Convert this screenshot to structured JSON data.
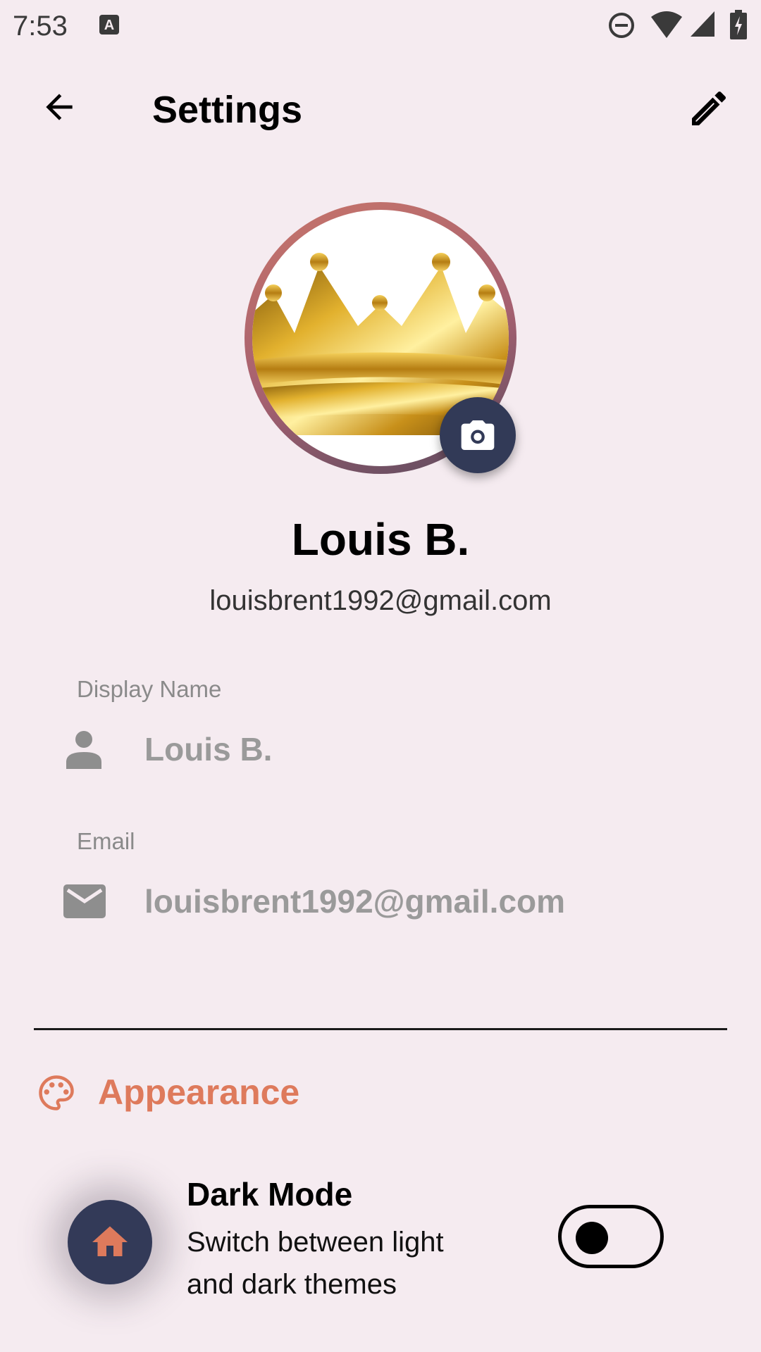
{
  "status_bar": {
    "time": "7:53",
    "icons": [
      "a-notification-icon",
      "do-not-disturb-icon",
      "wifi-icon",
      "signal-icon",
      "battery-charging-icon"
    ]
  },
  "app_bar": {
    "title": "Settings",
    "back_icon": "arrow-back-icon",
    "edit_icon": "pencil-icon"
  },
  "profile": {
    "name": "Louis B.",
    "email": "louisbrent1992@gmail.com",
    "avatar": "gold-crown-image",
    "camera_icon": "camera-icon"
  },
  "fields": {
    "display_name": {
      "label": "Display Name",
      "value": "Louis B.",
      "icon": "person-icon"
    },
    "email": {
      "label": "Email",
      "value": "louisbrent1992@gmail.com",
      "icon": "email-icon"
    }
  },
  "appearance": {
    "title": "Appearance",
    "icon": "palette-icon",
    "dark_mode": {
      "title": "Dark Mode",
      "description": "Switch between light and dark themes",
      "enabled": false
    }
  },
  "fab": {
    "icon": "home-icon"
  },
  "colors": {
    "background": "#f5ebf0",
    "accent": "#de7a5c",
    "dark_navy": "#333a58",
    "muted_text": "#9a9a9a"
  }
}
